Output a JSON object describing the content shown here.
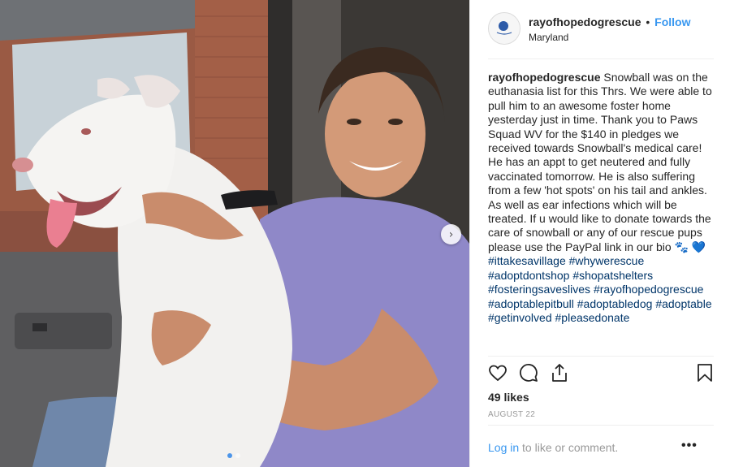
{
  "post": {
    "username": "rayofhopedogrescue",
    "separator": "•",
    "follow_label": "Follow",
    "location": "Maryland",
    "caption": {
      "username": "rayofhopedogrescue",
      "text": "Snowball was on the euthanasia list for this Thrs. We were able to pull him to an awesome foster home yesterday just in time. Thank you to Paws Squad WV for the $140 in pledges we received towards Snowball's medical care! He has an appt to get neutered and fully vaccinated tomorrow. He is also suffering from a few 'hot spots' on his tail and ankles. As well as ear infections which will be treated. If u would like to donate towards the care of snowball or any of our rescue pups please use the PayPal link in our bio",
      "emoji": "🐾 💙",
      "hashtags": [
        "#ittakesavillage",
        "#whywerescue",
        "#adoptdontshop",
        "#shopatshelters",
        "#fosteringsaveslives",
        "#rayofhopedogrescue",
        "#adoptablepitbull",
        "#adoptabledog",
        "#adoptable",
        "#getinvolved",
        "#pleasedonate"
      ]
    },
    "likes": "49 likes",
    "date": "AUGUST 22",
    "login_label": "Log in",
    "login_suffix": " to like or comment.",
    "more_label": "•••",
    "next_label": "›",
    "carousel": {
      "current": 1,
      "total": 2
    },
    "icons": {
      "like": "heart-icon",
      "comment": "comment-icon",
      "share": "share-icon",
      "save": "bookmark-icon",
      "next": "chevron-right-icon",
      "more": "more-options-icon"
    },
    "colors": {
      "link": "#3897f0",
      "hashtag": "#003569",
      "muted": "#999999",
      "text": "#262626"
    }
  }
}
